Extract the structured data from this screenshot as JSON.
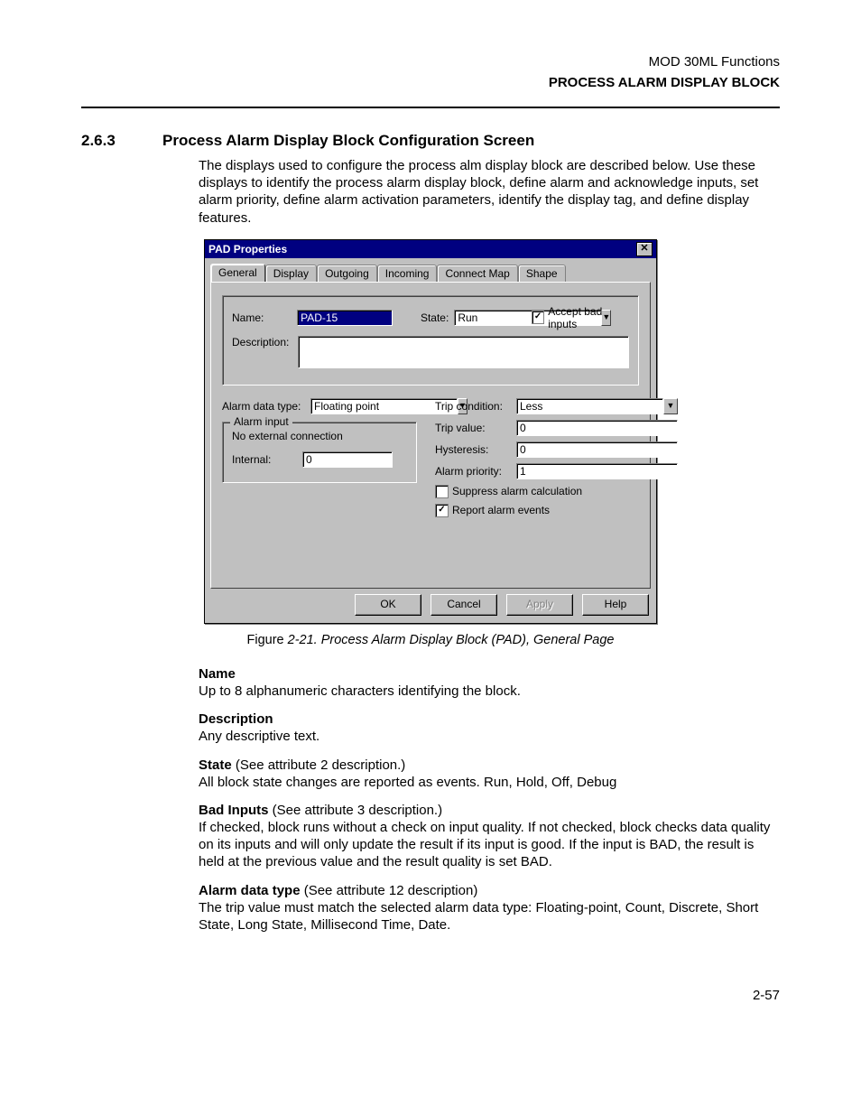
{
  "header": {
    "doc_title": "MOD 30ML Functions",
    "section_title": "PROCESS ALARM DISPLAY BLOCK"
  },
  "section_heading": {
    "number": "2.6.3",
    "title": "Process Alarm Display Block Configuration Screen"
  },
  "intro_para": "The displays used to configure the process alm display block are described below. Use these displays to identify the process alarm display block, define alarm and acknowledge inputs, set alarm priority, define alarm activation parameters, identify the display tag, and define display features.",
  "dialog": {
    "title": "PAD Properties",
    "close_glyph": "✕",
    "tabs": [
      "General",
      "Display",
      "Outgoing",
      "Incoming",
      "Connect Map",
      "Shape"
    ],
    "name_label": "Name:",
    "name_value": "PAD-15",
    "state_label": "State:",
    "state_value": "Run",
    "accept_bad_label": "Accept bad inputs",
    "accept_bad_checked": "✓",
    "desc_label": "Description:",
    "desc_value": "",
    "alarm_data_type_label": "Alarm data type:",
    "alarm_data_type_value": "Floating point",
    "alarm_input_legend": "Alarm input",
    "no_ext_conn": "No external connection",
    "internal_label": "Internal:",
    "internal_value": "0",
    "trip_condition_label": "Trip condition:",
    "trip_condition_value": "Less",
    "trip_value_label": "Trip value:",
    "trip_value_value": "0",
    "hysteresis_label": "Hysteresis:",
    "hysteresis_value": "0",
    "alarm_priority_label": "Alarm priority:",
    "alarm_priority_value": "1",
    "suppress_label": "Suppress alarm calculation",
    "report_label": "Report alarm events",
    "report_checked": "✓",
    "buttons": {
      "ok": "OK",
      "cancel": "Cancel",
      "apply": "Apply",
      "help": "Help"
    },
    "dropdown_glyph": "▼"
  },
  "figure_caption": {
    "prefix": "Figure ",
    "italic": "2-21. Process Alarm Display Block (PAD), General Page"
  },
  "definitions": {
    "name_term": "Name",
    "name_body": "Up to 8 alphanumeric characters identifying the block.",
    "desc_term": "Description",
    "desc_body": "Any descriptive text.",
    "state_term": "State",
    "state_note": " (See attribute 2 description.)",
    "state_body": "All block state changes are reported as events.  Run, Hold, Off, Debug",
    "bad_term": "Bad Inputs",
    "bad_note": " (See attribute 3 description.)",
    "bad_body": "If checked, block runs without a check on input quality. If not checked, block checks data quality on its inputs and will only update the result if its input is good.  If the input is BAD, the result is held at the previous value and the result quality is set BAD.",
    "adt_term": "Alarm data type",
    "adt_note": " (See attribute 12 description)",
    "adt_body": "The trip value must match the selected alarm data type: Floating-point, Count, Discrete, Short State, Long State, Millisecond Time, Date."
  },
  "page_number": "2-57"
}
